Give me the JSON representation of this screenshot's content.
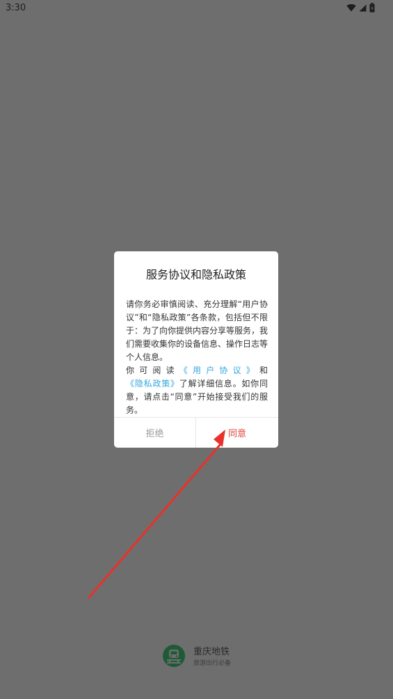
{
  "status_bar": {
    "time": "3:30",
    "icons": [
      "wifi-icon",
      "signal-icon",
      "battery-icon"
    ]
  },
  "dialog": {
    "title": "服务协议和隐私政策",
    "paragraph1": "请你务必审慎阅读、充分理解“用户协议”和“隐私政策”各条款，包括但不限于：为了向你提供内容分享等服务，我们需要收集你的设备信息、操作日志等个人信息。",
    "paragraph2_prefix": "你可阅读",
    "user_agreement_link": "《用户协议》",
    "and_text": "和",
    "privacy_policy_link": "《隐私政策》",
    "paragraph2_suffix": "了解详细信息。如你同意，请点击“同意”开始接受我们的服务。",
    "reject_label": "拒绝",
    "agree_label": "同意"
  },
  "brand": {
    "name": "重庆地铁",
    "slogan": "旅游出行必备"
  },
  "colors": {
    "overlay": "#6e6e6e",
    "link": "#35a6de",
    "agree": "#e2453c",
    "reject": "#9a9a9a",
    "annotation_arrow": "#e8322b",
    "brand_logo": "#1e5a36"
  }
}
